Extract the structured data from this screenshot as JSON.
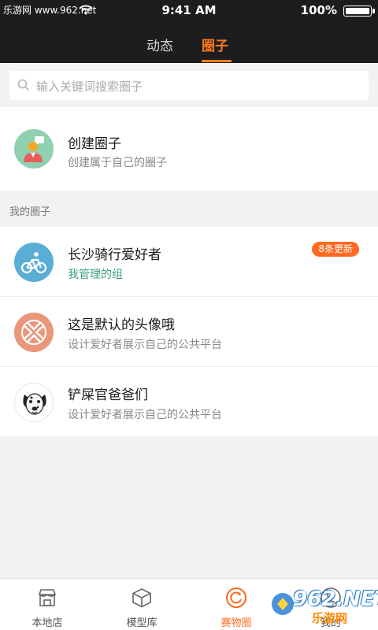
{
  "status": {
    "carrier": "乐游网 www.962.net",
    "time": "9:41 AM",
    "battery": "100%"
  },
  "nav": {
    "tab_dynamic": "动态",
    "tab_circles": "圈子"
  },
  "search": {
    "placeholder": "输入关键词搜索圈子"
  },
  "create": {
    "title": "创建圈子",
    "subtitle": "创建属于自己的圈子"
  },
  "my_section_label": "我的圈子",
  "circles": [
    {
      "title": "长沙骑行爱好者",
      "subtitle": "我管理的组",
      "badge": "8条更新",
      "icon": "bicycle-icon"
    },
    {
      "title": "这是默认的头像哦",
      "subtitle": "设计爱好者展示自己的公共平台",
      "icon": "default-avatar-icon"
    },
    {
      "title": "铲屎官爸爸们",
      "subtitle": "设计爱好者展示自己的公共平台",
      "icon": "dog-avatar-icon"
    }
  ],
  "tabbar": [
    {
      "label": "本地店",
      "icon": "store-icon"
    },
    {
      "label": "模型库",
      "icon": "cube-icon"
    },
    {
      "label": "赛物圈",
      "icon": "circle-refresh-icon",
      "active": true
    },
    {
      "label": "我的",
      "icon": "user-icon"
    }
  ],
  "watermark": {
    "logo": "962.NET",
    "text": "乐游网"
  },
  "colors": {
    "accent": "#ff7a1a",
    "badge": "#ff6a1f",
    "manager_green": "#3ea37a",
    "header_bg": "#1d1d1f"
  }
}
